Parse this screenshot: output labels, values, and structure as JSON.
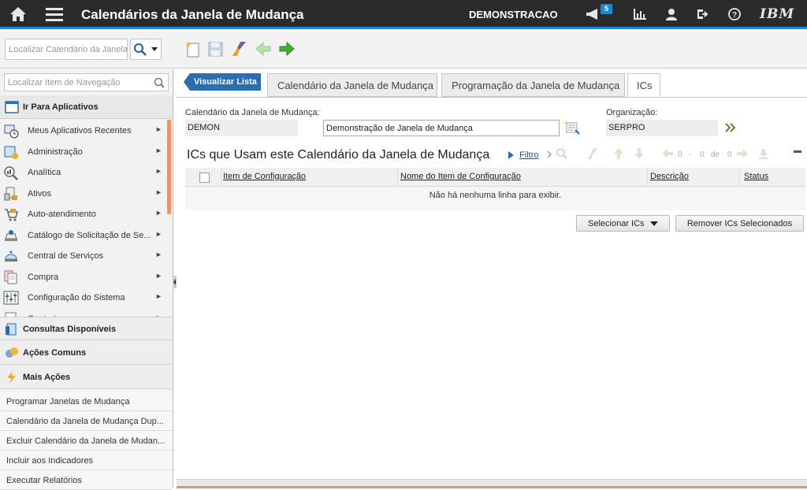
{
  "header": {
    "title": "Calendários da Janela de Mudança",
    "user": "DEMONSTRACAO",
    "notification_count": "5",
    "logo": "IBM",
    "icons": [
      "home-icon",
      "menu-icon",
      "megaphone-icon",
      "report-icon",
      "user-icon",
      "logout-icon",
      "help-icon"
    ]
  },
  "toolbar": {
    "search_placeholder": "Localizar Calendário da Janela",
    "buttons": [
      "new-record-icon",
      "save-icon",
      "clear-icon",
      "previous-icon",
      "next-icon"
    ]
  },
  "leftnav": {
    "search_placeholder": "Localizar Item de Navegação",
    "go_to_apps": "Ir Para Aplicativos",
    "items": [
      {
        "label": "Meus Aplicativos Recentes"
      },
      {
        "label": "Administração"
      },
      {
        "label": "Analítica"
      },
      {
        "label": "Ativos"
      },
      {
        "label": "Auto-atendimento"
      },
      {
        "label": "Catálogo de Solicitação de Se..."
      },
      {
        "label": "Central de Serviços"
      },
      {
        "label": "Compra"
      },
      {
        "label": "Configuração do Sistema"
      },
      {
        "label": "Contratos"
      }
    ],
    "queries": "Consultas Disponíveis",
    "common_actions": "Ações Comuns",
    "more_actions": "Mais Ações",
    "actions": [
      "Programar Janelas de Mudança",
      "Calendário da Janela de Mudança Dup...",
      "Excluir Calendário da Janela de Mudan...",
      "Incluir aos Indicadores",
      "Executar Relatórios"
    ]
  },
  "tabs": {
    "list": "Visualizar Lista",
    "items": [
      "Calendário da Janela de Mudança",
      "Programação da Janela de Mudança",
      "ICs"
    ],
    "active": "ICs"
  },
  "form": {
    "calendar_label": "Calendário da Janela de Mudança:",
    "calendar_value": "DEMON",
    "description_value": "Demonstração de Janela de Mudança",
    "org_label": "Organização:",
    "org_value": "SERPRO"
  },
  "grid": {
    "title": "ICs que Usam este Calendário da Janela de Mudança",
    "filter": "Filtro",
    "pagination": {
      "from": "0",
      "sep1": "-",
      "to": "0",
      "of_label": "de",
      "total": "0"
    },
    "columns": [
      "Item de Configuração",
      "Nome do Item de Configuração",
      "Descrição",
      "Status"
    ],
    "empty_message": "Não há nenhuma linha para exibir.",
    "select_button": "Selecionar ICs",
    "remove_button": "Remover ICs Selecionados"
  }
}
